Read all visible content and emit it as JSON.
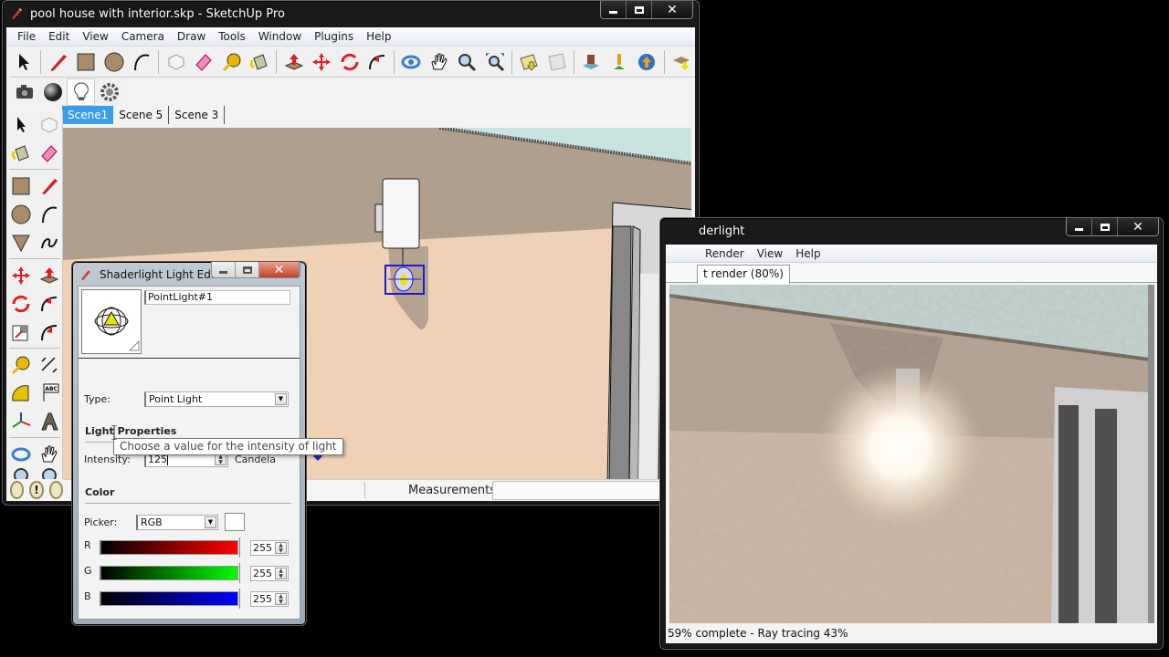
{
  "sketchup": {
    "title": "pool house with interior.skp - SketchUp Pro",
    "menu": [
      "File",
      "Edit",
      "View",
      "Camera",
      "Draw",
      "Tools",
      "Window",
      "Plugins",
      "Help"
    ],
    "toolbar_main": [
      "select-icon",
      "pencil-line-icon",
      "rectangle-icon",
      "circle-icon",
      "arc-icon",
      "make-component-icon",
      "eraser-icon",
      "tape-measure-icon",
      "paint-bucket-icon",
      "push-pull-icon",
      "move-icon",
      "rotate-icon",
      "follow-me-icon",
      "orbit-icon",
      "pan-icon",
      "zoom-icon",
      "zoom-extents-icon",
      "add-location-icon",
      "toggle-terrain-icon",
      "get-models-icon",
      "share-model-icon",
      "preview-google-earth-icon",
      "get-components-icon"
    ],
    "toolbar_shaderlight": [
      "render-camera-icon",
      "material-sphere-icon",
      "light-bulb-icon",
      "settings-gear-icon"
    ],
    "scene_tabs": [
      {
        "label": "Scene1",
        "active": true
      },
      {
        "label": "Scene 5",
        "active": false
      },
      {
        "label": "Scene 3",
        "active": false
      }
    ],
    "left_toolbar": [
      "select-icon",
      "make-component-icon",
      "paint-bucket-icon",
      "eraser-icon",
      "rectangle-icon",
      "pencil-line-icon",
      "circle-icon",
      "arc-icon",
      "polygon-icon",
      "freehand-icon",
      "move-icon",
      "push-pull-icon",
      "rotate-icon",
      "follow-me-icon",
      "scale-icon",
      "offset-icon",
      "tape-measure-icon",
      "dimension-icon",
      "protractor-icon",
      "text-icon",
      "axes-icon",
      "3d-text-icon",
      "orbit-icon",
      "pan-icon",
      "zoom-icon",
      "zoom-extents-icon"
    ],
    "bottom_left_icons": [
      "geo-location-icon",
      "credits-icon",
      "instructor-icon"
    ],
    "status": {
      "measurements_label": "Measurements",
      "measurements_value": ""
    }
  },
  "light_editor": {
    "title": "Shaderlight Light Edi...",
    "light_name": "PointLight#1",
    "type_label": "Type:",
    "type_value": "Point Light",
    "light_properties_heading": "Light Properties",
    "intensity_label": "Intensity:",
    "intensity_value": "125",
    "intensity_unit": "Candela",
    "tooltip": "Choose a value for the intensity of light",
    "color_heading": "Color",
    "picker_label": "Picker:",
    "picker_value": "RGB",
    "swatch_color": "#ffffff",
    "channels": [
      {
        "label": "R",
        "value": "255",
        "color": "#ff0000"
      },
      {
        "label": "G",
        "value": "255",
        "color": "#00ff00"
      },
      {
        "label": "B",
        "value": "255",
        "color": "#0000ff"
      }
    ]
  },
  "shaderlight": {
    "title": "Shaderlight",
    "title_visible": "derlight",
    "menu": [
      "Render",
      "View",
      "Help"
    ],
    "tab_label": "t render (80%)",
    "status": "59% complete - Ray tracing 43%",
    "progress_percent": 59,
    "ray_tracing_percent": 43
  },
  "window_controls": {
    "minimize": "minimize",
    "maximize": "maximize",
    "close": "✕"
  }
}
